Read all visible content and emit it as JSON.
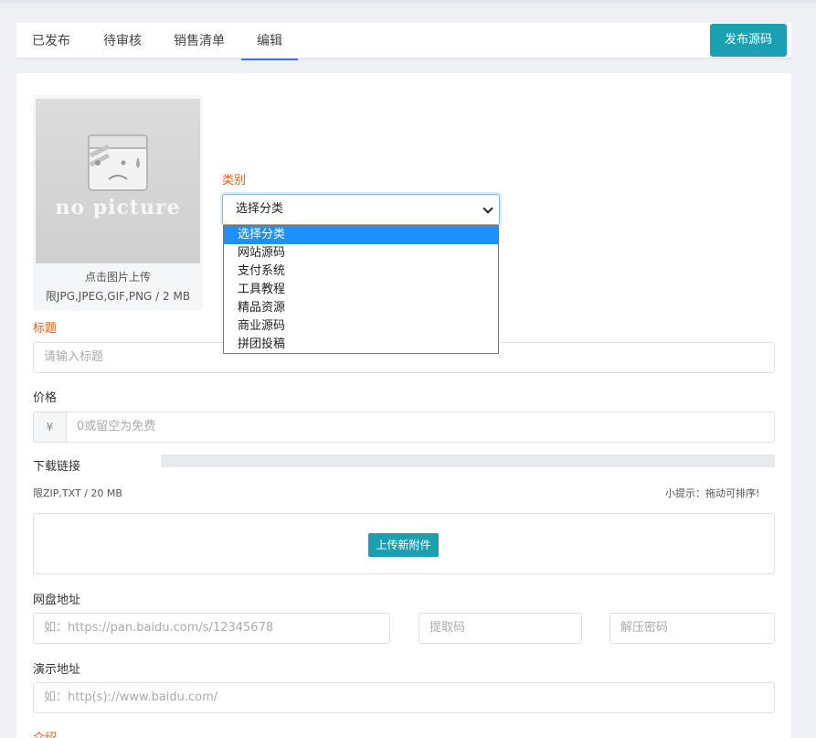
{
  "tabs": [
    {
      "label": "已发布"
    },
    {
      "label": "待审核"
    },
    {
      "label": "销售清单"
    },
    {
      "label": "编辑"
    }
  ],
  "active_tab": "编辑",
  "publish_button": "发布源码",
  "image_upload": {
    "placeholder_text": "no picture",
    "hint": "点击图片上传",
    "limit": "限JPG,JPEG,GIF,PNG / 2 MB"
  },
  "category": {
    "label": "类别",
    "selected": "选择分类",
    "options": [
      "选择分类",
      "网站源码",
      "支付系统",
      "工具教程",
      "精品资源",
      "商业源码",
      "拼团投稿"
    ]
  },
  "title_field": {
    "label": "标题",
    "placeholder": "请输入标题"
  },
  "price_field": {
    "label": "价格",
    "currency": "¥",
    "placeholder": "0或留空为免费"
  },
  "download": {
    "label": "下载链接",
    "limit": "限ZIP,TXT / 20 MB",
    "tip": "小提示：拖动可排序!",
    "upload_button": "上传新附件"
  },
  "netdisk": {
    "label": "网盘地址",
    "url_placeholder": "如：https://pan.baidu.com/s/12345678",
    "code_placeholder": "提取码",
    "password_placeholder": "解压密码"
  },
  "demo": {
    "label": "演示地址",
    "placeholder": "如：http(s)://www.baidu.com/"
  },
  "intro": {
    "label": "介绍"
  },
  "colors": {
    "accent": "#1ba0b2",
    "required_label": "#e0631a",
    "tab_active": "#4a6ee0",
    "option_selected": "#1e90ff"
  }
}
